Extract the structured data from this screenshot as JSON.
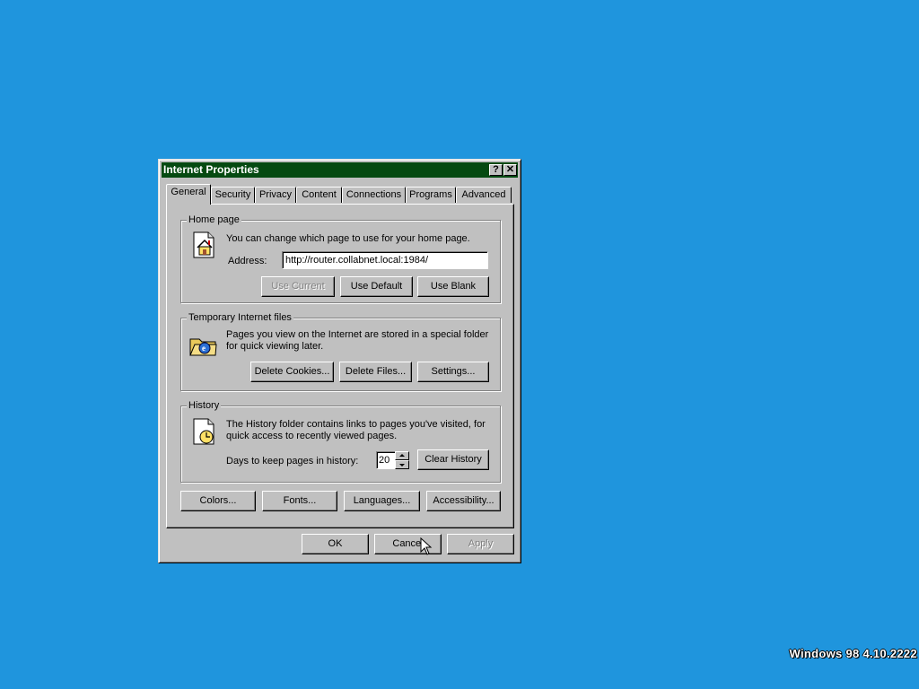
{
  "window": {
    "title": "Internet Properties",
    "help_button": "?",
    "close_button": "✕"
  },
  "tabs": [
    {
      "label": "General",
      "active": true
    },
    {
      "label": "Security"
    },
    {
      "label": "Privacy"
    },
    {
      "label": "Content"
    },
    {
      "label": "Connections"
    },
    {
      "label": "Programs"
    },
    {
      "label": "Advanced"
    }
  ],
  "home_page": {
    "legend": "Home page",
    "description": "You can change which page to use for your home page.",
    "address_label": "Address:",
    "address_value": "http://router.collabnet.local:1984/",
    "use_current": "Use Current",
    "use_default": "Use Default",
    "use_blank": "Use Blank"
  },
  "temp_files": {
    "legend": "Temporary Internet files",
    "description_line1": "Pages you view on the Internet are stored in a special folder",
    "description_line2": "for quick viewing later.",
    "delete_cookies": "Delete Cookies...",
    "delete_files": "Delete Files...",
    "settings": "Settings..."
  },
  "history": {
    "legend": "History",
    "description_line1": "The History folder contains links to pages you've visited, for",
    "description_line2": "quick access to recently viewed pages.",
    "days_label": "Days to keep pages in history:",
    "days_value": "20",
    "clear_history": "Clear History"
  },
  "bottom_buttons": {
    "colors": "Colors...",
    "fonts": "Fonts...",
    "languages": "Languages...",
    "accessibility": "Accessibility..."
  },
  "dialog_buttons": {
    "ok": "OK",
    "cancel": "Cancel",
    "apply": "Apply"
  },
  "desktop": {
    "version_text": "Windows 98 4.10.2222"
  },
  "colors": {
    "desktop": "#1f95dd",
    "titlebar": "#054a11",
    "face": "#c0c0c0"
  }
}
